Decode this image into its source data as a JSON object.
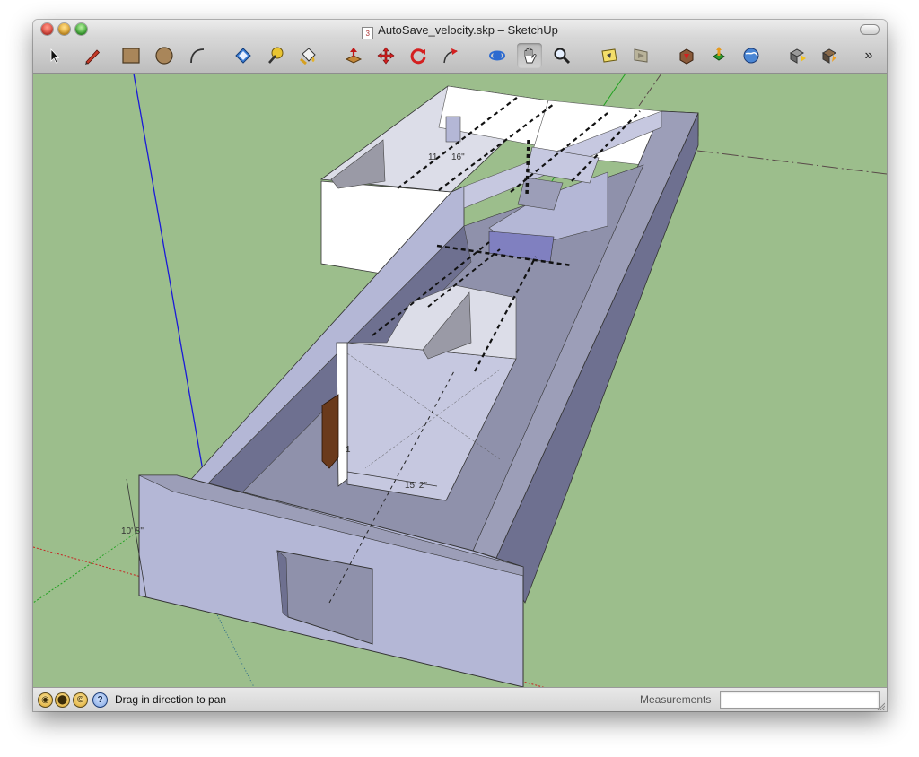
{
  "window": {
    "title": "AutoSave_velocity.skp – SketchUp",
    "document_icon": "skp-document-icon"
  },
  "toolbar": {
    "tools": [
      {
        "name": "select-tool",
        "icon": "arrow-cursor-icon"
      },
      {
        "name": "pencil-tool",
        "icon": "pencil-icon"
      },
      {
        "name": "rectangle-tool",
        "icon": "rectangle-icon"
      },
      {
        "name": "circle-tool",
        "icon": "circle-icon"
      },
      {
        "name": "arc-tool",
        "icon": "arc-icon"
      },
      {
        "name": "eraser-tool",
        "icon": "eraser-icon"
      },
      {
        "name": "tape-measure-tool",
        "icon": "tape-measure-icon"
      },
      {
        "name": "paint-bucket-tool",
        "icon": "paint-bucket-icon"
      },
      {
        "name": "push-pull-tool",
        "icon": "push-pull-icon"
      },
      {
        "name": "move-tool",
        "icon": "move-icon"
      },
      {
        "name": "rotate-tool",
        "icon": "rotate-icon"
      },
      {
        "name": "follow-me-tool",
        "icon": "follow-me-icon"
      },
      {
        "name": "orbit-tool",
        "icon": "orbit-icon"
      },
      {
        "name": "pan-tool",
        "icon": "hand-icon",
        "active": true
      },
      {
        "name": "zoom-tool",
        "icon": "magnifier-icon"
      },
      {
        "name": "previous-view-tool",
        "icon": "previous-view-icon"
      },
      {
        "name": "next-view-tool",
        "icon": "next-view-icon"
      },
      {
        "name": "get-models-tool",
        "icon": "get-models-icon"
      },
      {
        "name": "share-model-tool",
        "icon": "share-model-icon"
      },
      {
        "name": "google-earth-tool",
        "icon": "earth-icon"
      },
      {
        "name": "get-components-tool",
        "icon": "components-icon"
      },
      {
        "name": "extension-tool",
        "icon": "extension-icon"
      }
    ],
    "overflow_label": "»"
  },
  "viewport": {
    "dimensions": {
      "height_label": "10' 8\"",
      "width_label": "15' 2\"",
      "small_label": "11",
      "small_label_2": "16\"",
      "door_label": "1"
    },
    "colors": {
      "ground": "#9cbe8c",
      "wall_face": "#b4b7d6",
      "wall_top": "#9c9eb8",
      "wall_dark": "#6e7090",
      "floor": "#8f91ab",
      "door": "#6a3a1c",
      "axis_blue": "#1a1ad8",
      "axis_red": "#c82020",
      "axis_green": "#20a020"
    }
  },
  "statusbar": {
    "icons": [
      "geo-location-icon",
      "credits-icon",
      "copyright-icon",
      "help-icon"
    ],
    "help_glyph": "?",
    "message": "Drag in direction to pan",
    "measurements_label": "Measurements",
    "measurements_value": ""
  }
}
